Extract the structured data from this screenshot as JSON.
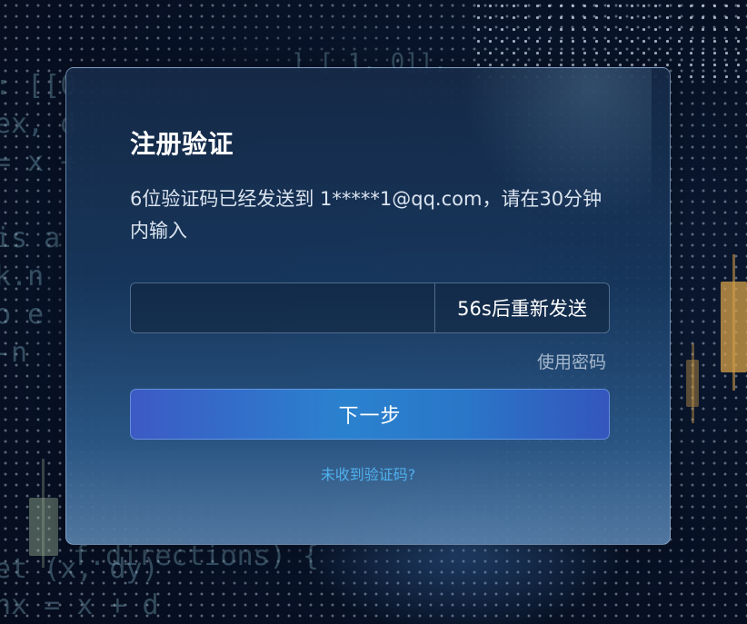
{
  "dialog": {
    "title": "注册验证",
    "description": "6位验证码已经发送到 1*****1@qq.com，请在30分钟内输入",
    "code_input": {
      "value": "",
      "placeholder": ""
    },
    "resend_label": "56s后重新发送",
    "use_password_label": "使用密码",
    "next_label": "下一步",
    "no_code_label": "未收到验证码?"
  },
  "colors": {
    "accent_button_start": "#3c5ac4",
    "accent_button_mid": "#2a82cf",
    "link": "#4fb0ee",
    "title_text": "#ffffff"
  }
}
